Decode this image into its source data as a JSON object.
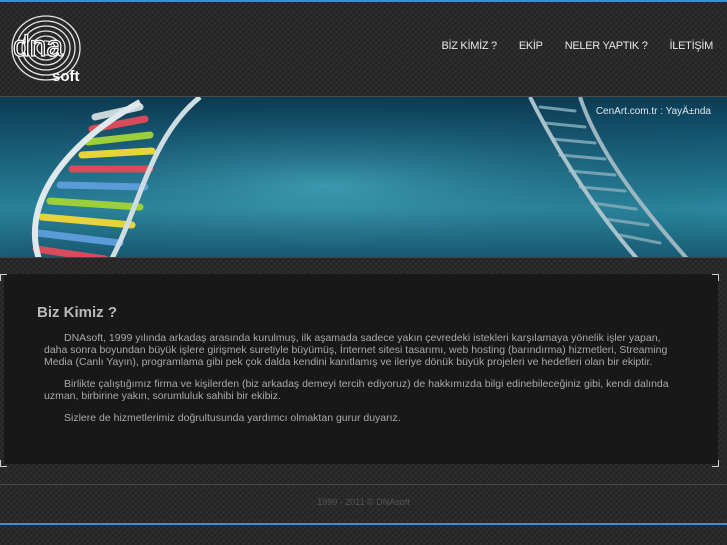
{
  "logo": {
    "text_top": "dna",
    "text_bottom": "soft"
  },
  "nav": {
    "items": [
      {
        "label": "BİZ KİMİZ ?"
      },
      {
        "label": "EKİP"
      },
      {
        "label": "NELER YAPTIK ?"
      },
      {
        "label": "İLETİŞİM"
      }
    ]
  },
  "banner": {
    "credit": "CenArt.com.tr : YayÄ±nda"
  },
  "main": {
    "title": "Biz Kimiz ?",
    "paragraphs": [
      "DNAsoft, 1999 yılında arkadaş arasında kurulmuş, ilk aşamada sadece yakın çevredeki istekleri karşılamaya yönelik işler yapan, daha sonra boyundan büyük işlere girişmek suretiyle büyümüş, İnternet sitesi tasarımı, web hosting (barındırma) hizmetleri, Streaming Media (Canlı Yayın), programlama gibi pek çok dalda kendini kanıtlamış ve ileriye dönük büyük projeleri ve hedefleri olan bir ekiptir.",
      "Birlikte çalıştığımız firma ve kişilerden (biz arkadaş demeyi tercih ediyoruz) de hakkımızda bilgi edinebileceğiniz gibi, kendi dalında uzman, birbirine yakın, sorumluluk sahibi bir ekibiz.",
      "Sizlere de hizmetlerimiz doğrultusunda yardımcı olmaktan gurur duyarız."
    ]
  },
  "footer": {
    "copyright": "1999 - 2011 © DNAsoft"
  },
  "colors": {
    "accent_line": "#3a8fd8",
    "background": "#2a2a2a",
    "content_panel": "#181818"
  }
}
